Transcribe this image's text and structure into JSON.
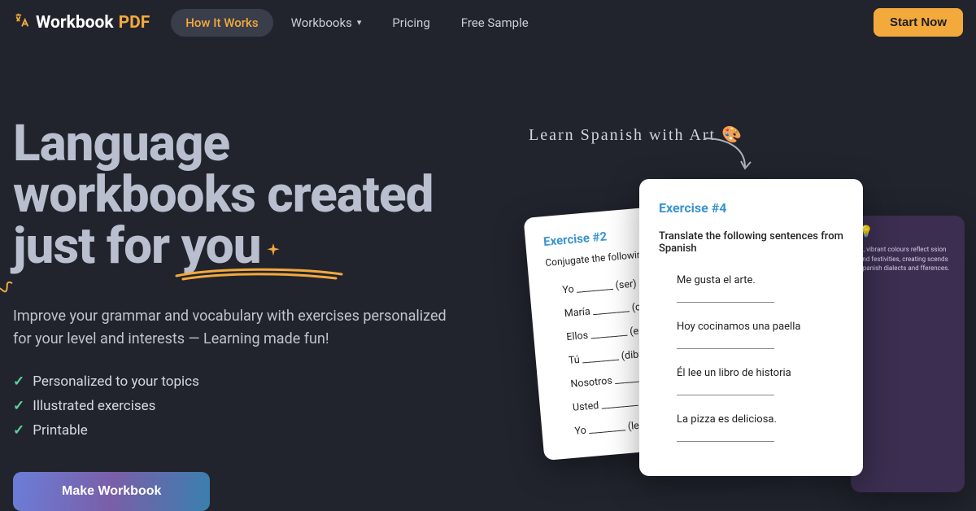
{
  "nav": {
    "brand_a": "Workbook",
    "brand_b": "PDF",
    "how": "How It Works",
    "workbooks": "Workbooks",
    "pricing": "Pricing",
    "sample": "Free Sample",
    "start": "Start Now"
  },
  "hero": {
    "line1": "Language",
    "line2": "workbooks created",
    "line3a": "just for ",
    "line3b": "you",
    "sub": "Improve your grammar and vocabulary with exercises personalized for your level and interests — Learning made fun!",
    "features": {
      "a": "Personalized to your topics",
      "b": "Illustrated exercises",
      "c": "Printable"
    },
    "cta": "Make Workbook"
  },
  "mock": {
    "hand": "Learn Spanish with Art 🎨",
    "back": {
      "title": "Exercise #2",
      "sub": "Conjugate the following",
      "items": [
        "Yo ________ (ser) a",
        "María ________ (co",
        "Ellos ________ (es",
        "Tú ________ (dibu",
        "Nosotros ________",
        "Usted ________ ",
        "Yo ________ (lee"
      ]
    },
    "front": {
      "title": "Exercise #4",
      "sub": "Translate the following sentences from Spanish",
      "items": [
        "Me gusta el arte.",
        "Hoy cocinamos una paella",
        "Él lee un libro de historia",
        "La pizza es deliciosa."
      ]
    },
    "dark": {
      "text": "rt, vibrant colours reflect ssion and festivities, creating scends Spanish dialects and fferences."
    }
  }
}
